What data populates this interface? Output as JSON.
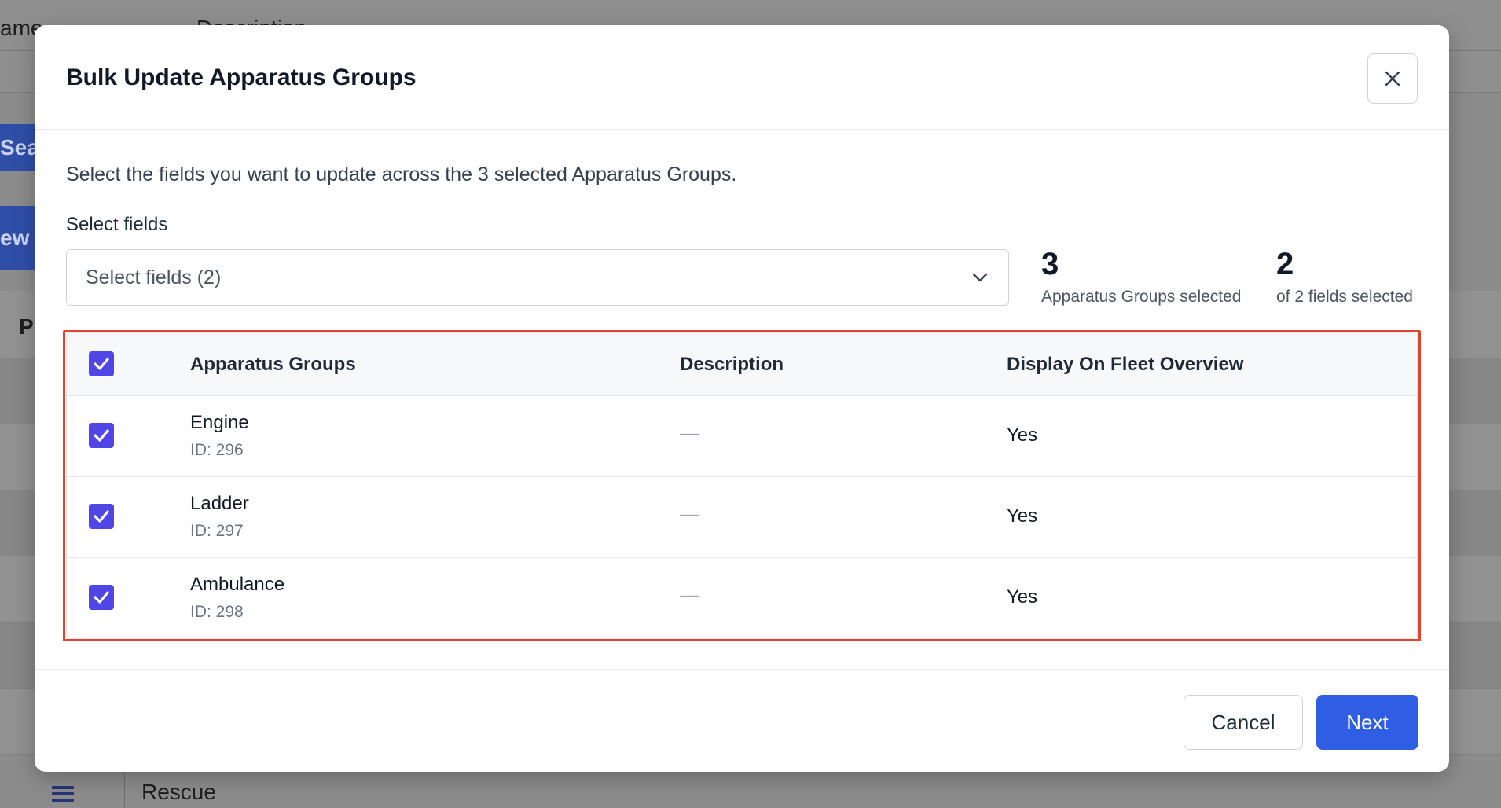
{
  "background": {
    "header_name_fragment": "ame",
    "header_desc_fragment": "Description",
    "search_button_fragment": "Sear",
    "new_button_fragment": "ew",
    "column_fragment": "P",
    "bottom_row_name": "Rescue",
    "menu_icon": "hamburger-menu-icon"
  },
  "modal": {
    "title": "Bulk Update Apparatus Groups",
    "close_icon": "close-icon",
    "intro": "Select the fields you want to update across the 3 selected Apparatus Groups.",
    "select_label": "Select fields",
    "select_value": "Select fields (2)",
    "select_icon": "chevron-down-icon",
    "stats": [
      {
        "number": "3",
        "label": "Apparatus Groups selected"
      },
      {
        "number": "2",
        "label": "of 2 fields selected"
      }
    ],
    "table": {
      "headers": {
        "name": "Apparatus Groups",
        "description": "Description",
        "display": "Display On Fleet Overview"
      },
      "header_checked": true,
      "rows": [
        {
          "name": "Engine",
          "id": "ID: 296",
          "description": "—",
          "display": "Yes",
          "checked": true
        },
        {
          "name": "Ladder",
          "id": "ID: 297",
          "description": "—",
          "display": "Yes",
          "checked": true
        },
        {
          "name": "Ambulance",
          "id": "ID: 298",
          "description": "—",
          "display": "Yes",
          "checked": true
        }
      ]
    },
    "footer": {
      "cancel_label": "Cancel",
      "next_label": "Next"
    }
  },
  "colors": {
    "accent": "#2f5ee5",
    "checkbox": "#4f46e5",
    "highlight": "#e0442f"
  }
}
